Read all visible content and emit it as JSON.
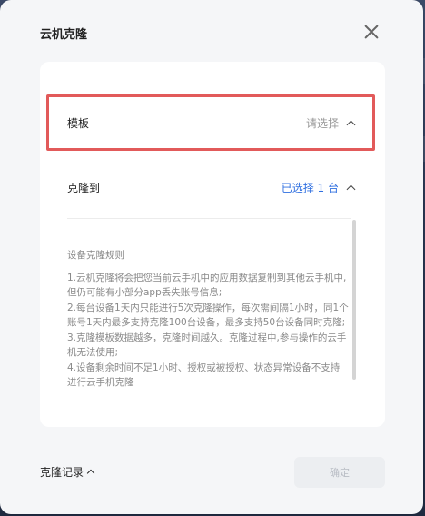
{
  "dialog": {
    "title": "云机克隆",
    "template_row": {
      "label": "模板",
      "value": "请选择"
    },
    "target_row": {
      "label": "克隆到",
      "value": "已选择 1 台"
    },
    "description": {
      "title": "设备克隆规则",
      "lines": [
        "1.云机克隆将会把您当前云手机中的应用数据复制到其他云手机中,但仍可能有小部分app丢失账号信息;",
        "2.每台设备1天内只能进行5次克隆操作，每次需间隔1小时，同1个账号1天内最多支持克隆100台设备，最多支持50台设备同时克隆;",
        "3.克隆模板数据越多，克隆时间越久。克隆过程中,参与操作的云手机无法使用;",
        "4.设备剩余时间不足1小时、授权或被授权、状态异常设备不支持进行云手机克隆"
      ]
    },
    "footer": {
      "history_link": "克隆记录",
      "confirm_button": "确定"
    }
  },
  "colors": {
    "accent": "#2f6fe0",
    "highlight": "#e25a5a"
  },
  "icons": {
    "close": "close-icon",
    "chevron": "chevron-up-icon"
  }
}
